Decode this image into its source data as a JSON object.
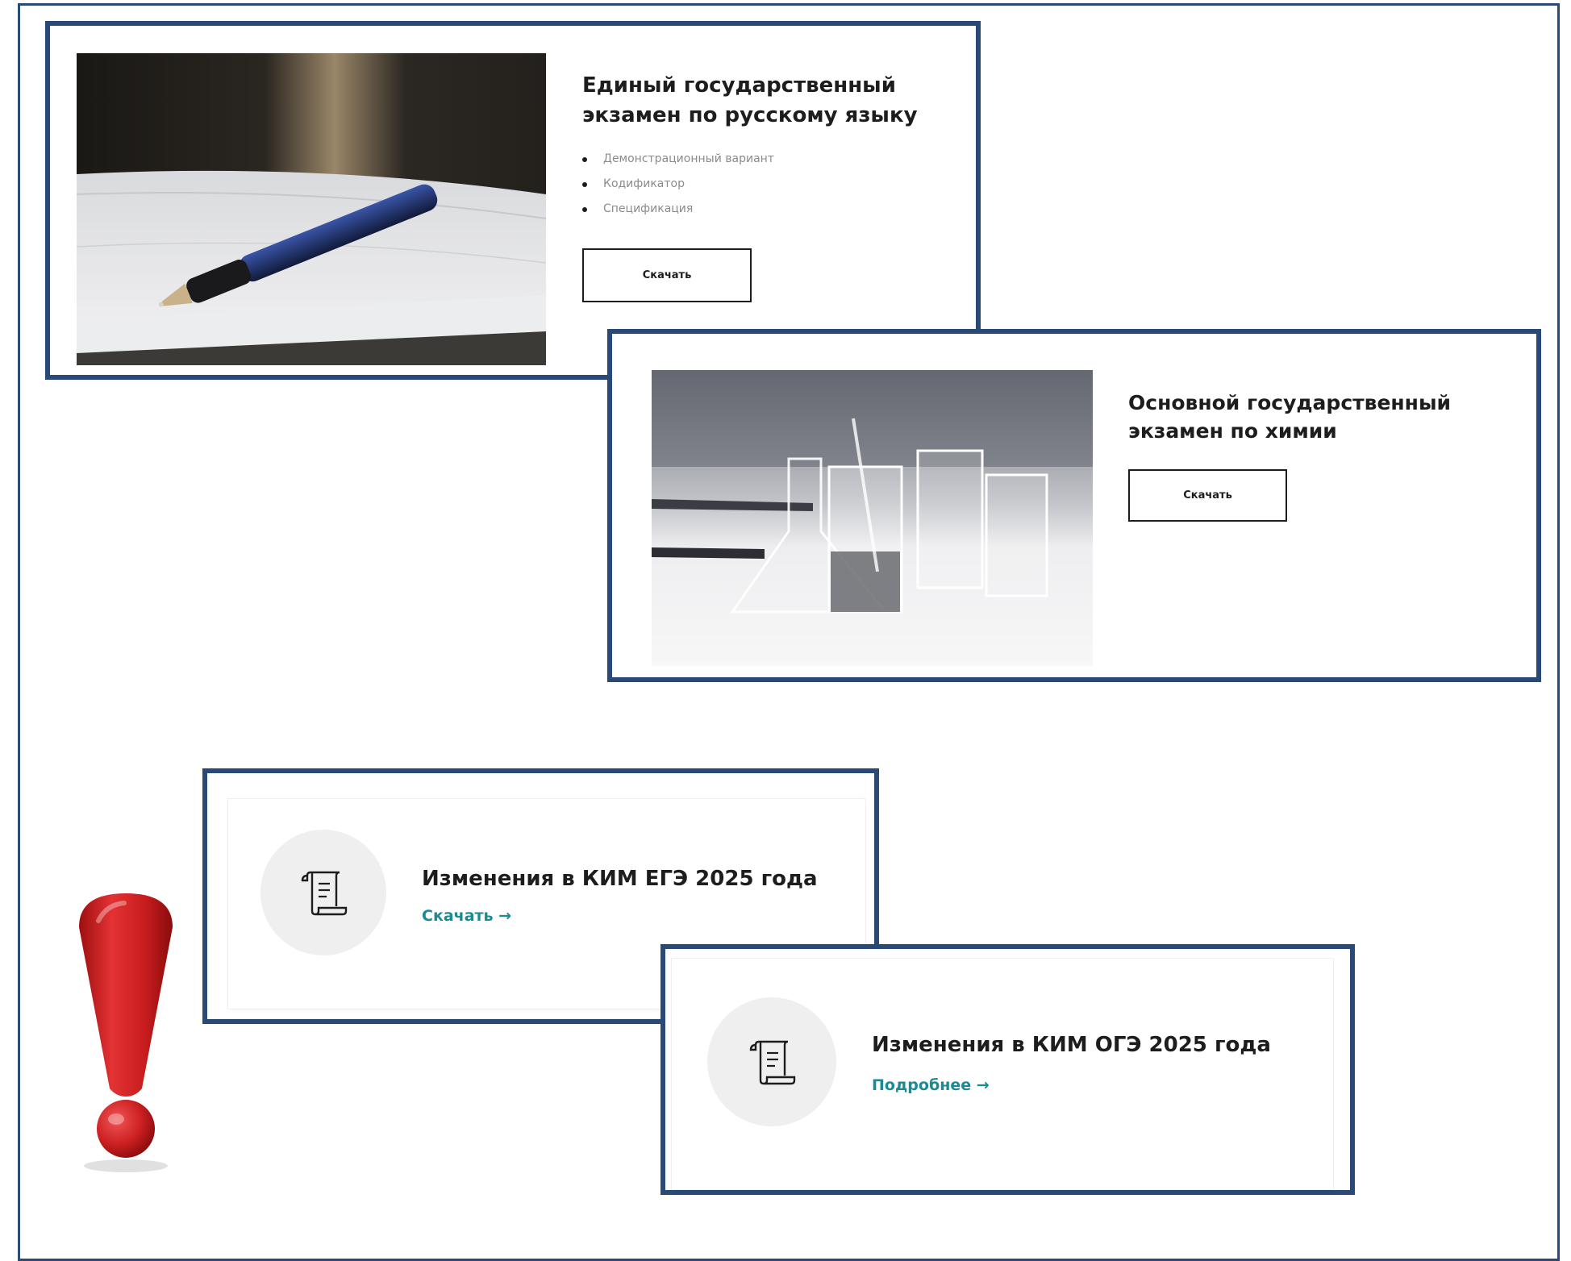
{
  "cards": {
    "russian": {
      "title": "Единый государственный экзамен по русскому языку",
      "documents": [
        "Демонстрационный вариант",
        "Кодификатор",
        "Спецификация"
      ],
      "button_label": "Скачать"
    },
    "chemistry": {
      "title": "Основной государственный экзамен по химии",
      "button_label": "Скачать"
    },
    "kim_ege": {
      "title": "Изменения в КИМ ЕГЭ 2025 года",
      "link_label": "Скачать →"
    },
    "kim_oge": {
      "title": "Изменения в КИМ ОГЭ 2025 года",
      "link_label": "Подробнее →"
    }
  },
  "colors": {
    "frame": "#294a76",
    "link": "#1a8a93",
    "exclamation": "#d01f1f"
  },
  "icons": {
    "document": "scroll-document-icon",
    "warning": "exclamation-mark-icon"
  }
}
